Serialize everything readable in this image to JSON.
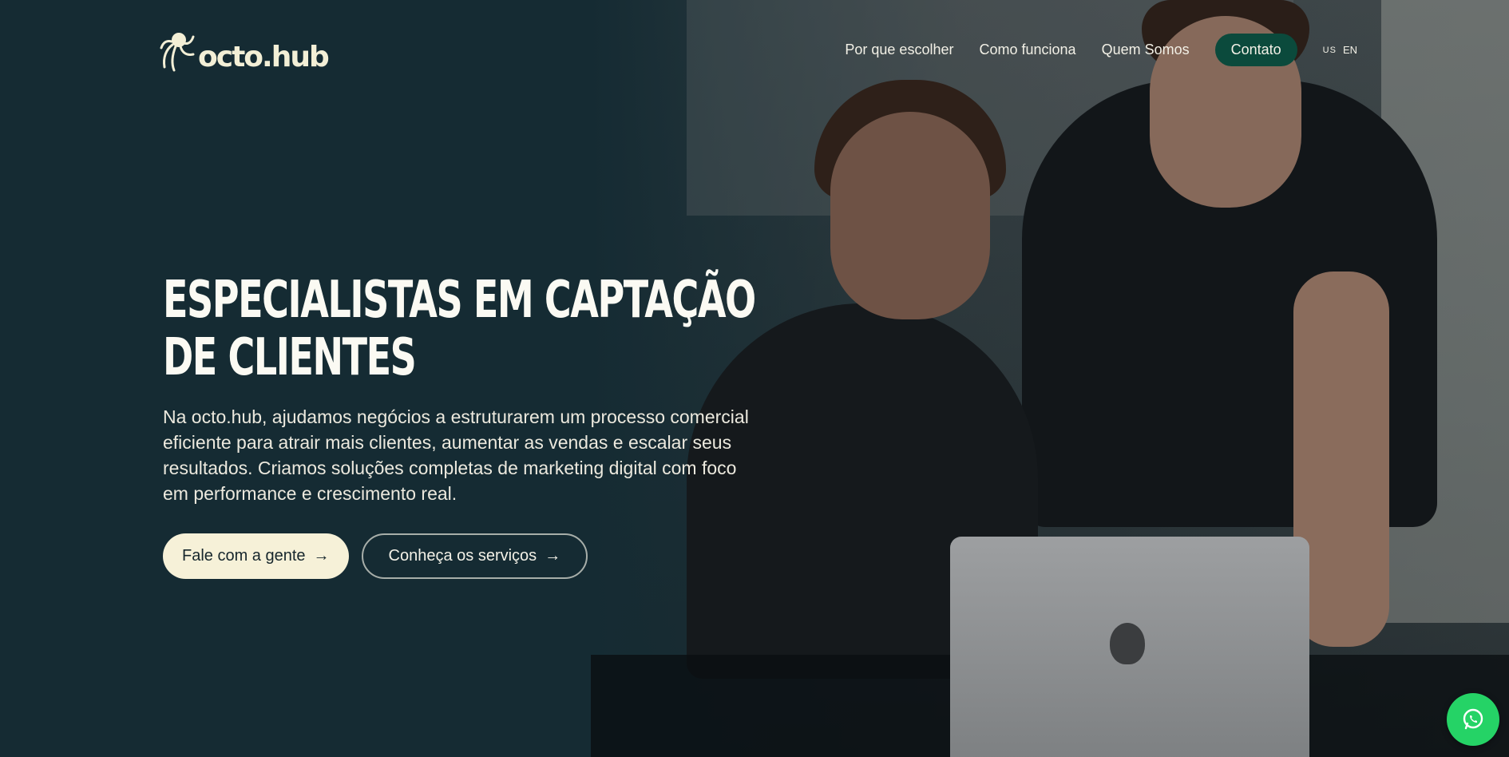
{
  "brand": {
    "name": "octo.hub"
  },
  "nav": {
    "links": [
      "Por que escolher",
      "Como funciona",
      "Quem Somos"
    ],
    "contact_label": "Contato",
    "lang_flag": "US",
    "lang_label": "EN"
  },
  "hero": {
    "headline": "Especialistas em captação de clientes",
    "paragraph": "Na octo.hub, ajudamos negócios a estruturarem um processo comercial eficiente para atrair mais clientes, aumentar as vendas e escalar seus resultados. Criamos soluções completas de marketing digital com foco em performance e crescimento real.",
    "primary_cta": "Fale com a gente",
    "secondary_cta": "Conheça os serviços",
    "arrow": "→"
  },
  "colors": {
    "background": "#152b33",
    "accent": "#0b4a3c",
    "cream": "#f6f1d8",
    "whatsapp": "#25d366"
  },
  "icons": {
    "logo": "octopus-icon",
    "floating": "whatsapp-icon"
  }
}
